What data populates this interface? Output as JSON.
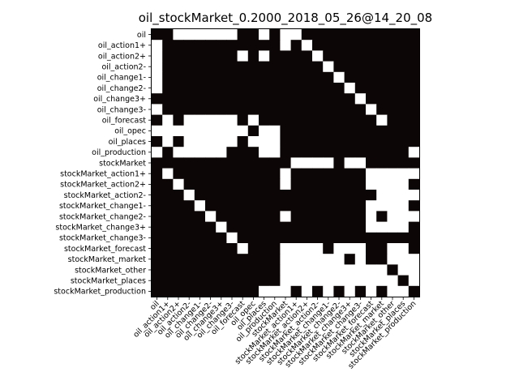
{
  "chart_data": {
    "type": "heatmap",
    "title": "oil_stockMarket_0.2000_2018_05_26@14_20_08",
    "labels": [
      "oil",
      "oil_action1+",
      "oil_action2+",
      "oil_action2-",
      "oil_change1-",
      "oil_change2-",
      "oil_change3+",
      "oil_change3-",
      "oil_forecast",
      "oil_opec",
      "oil_places",
      "oil_production",
      "stockMarket",
      "stockMarket_action1+",
      "stockMarket_action2+",
      "stockMarket_action2-",
      "stockMarket_change1-",
      "stockMarket_change2-",
      "stockMarket_change3+",
      "stockMarket_change3-",
      "stockMarket_forecast",
      "stockMarket_market",
      "stockMarket_other",
      "stockMarket_places",
      "stockMarket_production"
    ],
    "value_legend": {
      "1": "black",
      "0": "white"
    },
    "colors": {
      "on": "#0d0606",
      "off": "#ffffff"
    },
    "matrix": [
      "1100000011010011111111111",
      "0111111111110101111111111",
      "0111111101011110111111111",
      "0111111111111111011111111",
      "0111111111111111101111111",
      "0111111111111111110111111",
      "1111111111111111111011111",
      "0111111111111111111101111",
      "1010000010111111111110111",
      "0000000001001111111111111",
      "1010000010001111111111111",
      "0100000111001111111111110",
      "1111111111111000010011111",
      "1011111111110111111100000",
      "1101111111110111111100001",
      "1110111111111111111110000",
      "1111011111111111111100001",
      "1111101111110111111101000",
      "1111110111111111111100001",
      "1111111011111111111111111",
      "1111111101110000100011001",
      "1111111111110000001011000",
      "1111111111110000000000100",
      "1111111111110000000000010",
      "1111111111000101010101001"
    ]
  }
}
